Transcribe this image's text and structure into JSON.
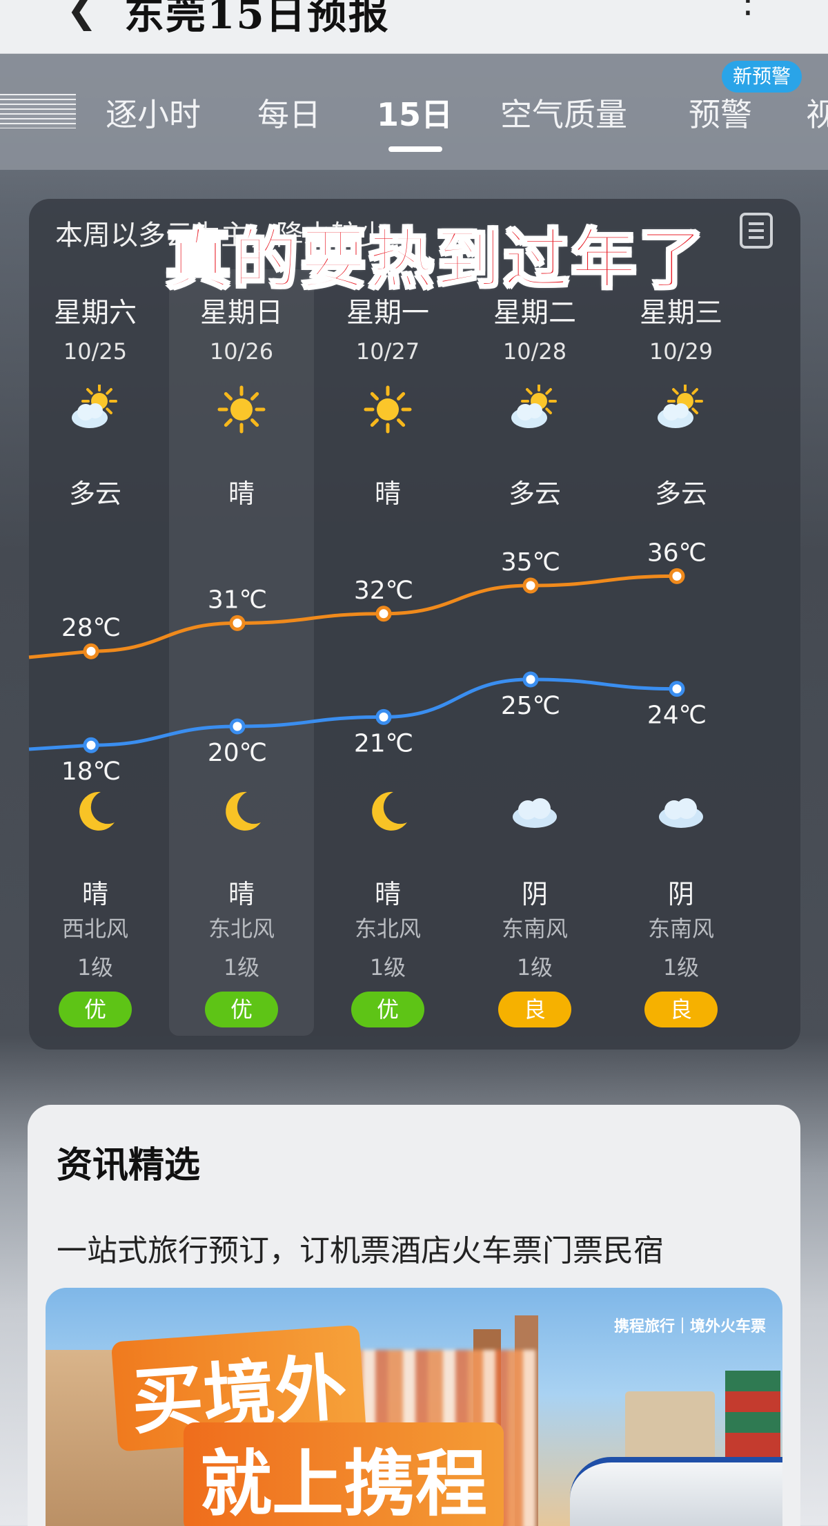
{
  "appbar": {
    "back_icon": "chevron-left-icon",
    "title": "东莞15日预报",
    "more_icon": "more-vertical-icon"
  },
  "tabs": [
    {
      "label": "逐小时",
      "active": false
    },
    {
      "label": "每日",
      "active": false
    },
    {
      "label": "15日",
      "active": true
    },
    {
      "label": "空气质量",
      "active": false
    },
    {
      "label": "预警",
      "active": false
    },
    {
      "label": "视",
      "active": false
    }
  ],
  "alert_badge": "新预警",
  "forecast": {
    "summary": "本周以多云为主，降水较少",
    "overlay_caption": "真的要热到过年了",
    "list_icon": "list-icon",
    "days": [
      {
        "weekday": "星期六",
        "date": "10/25",
        "day_icon": "partly-cloudy-icon",
        "day_cond": "多云",
        "high": "28℃",
        "low": "18℃",
        "night_icon": "moon-icon",
        "night_cond": "晴",
        "wind_dir": "西北风",
        "wind_lvl": "1级",
        "aqi": "优",
        "aqi_color": "#5ec416"
      },
      {
        "weekday": "星期日",
        "date": "10/26",
        "day_icon": "sun-icon",
        "day_cond": "晴",
        "high": "31℃",
        "low": "20℃",
        "night_icon": "moon-icon",
        "night_cond": "晴",
        "wind_dir": "东北风",
        "wind_lvl": "1级",
        "aqi": "优",
        "aqi_color": "#5ec416"
      },
      {
        "weekday": "星期一",
        "date": "10/27",
        "day_icon": "sun-icon",
        "day_cond": "晴",
        "high": "32℃",
        "low": "21℃",
        "night_icon": "moon-icon",
        "night_cond": "晴",
        "wind_dir": "东北风",
        "wind_lvl": "1级",
        "aqi": "优",
        "aqi_color": "#5ec416"
      },
      {
        "weekday": "星期二",
        "date": "10/28",
        "day_icon": "partly-cloudy-icon",
        "day_cond": "多云",
        "high": "35℃",
        "low": "25℃",
        "night_icon": "cloud-icon",
        "night_cond": "阴",
        "wind_dir": "东南风",
        "wind_lvl": "1级",
        "aqi": "良",
        "aqi_color": "#f6b100"
      },
      {
        "weekday": "星期三",
        "date": "10/29",
        "day_icon": "partly-cloudy-icon",
        "day_cond": "多云",
        "high": "36℃",
        "low": "24℃",
        "night_icon": "cloud-icon",
        "night_cond": "阴",
        "wind_dir": "东南风",
        "wind_lvl": "1级",
        "aqi": "良",
        "aqi_color": "#f6b100"
      }
    ],
    "colors": {
      "high_line": "#f08a1c",
      "low_line": "#3a8ef0"
    }
  },
  "chart_data": {
    "type": "line",
    "categories": [
      "10/25",
      "10/26",
      "10/27",
      "10/28",
      "10/29"
    ],
    "series": [
      {
        "values": [
          28,
          31,
          32,
          35,
          36
        ]
      },
      {
        "values": [
          18,
          20,
          21,
          25,
          24
        ]
      }
    ],
    "ylim": [
      15,
      40
    ]
  },
  "news": {
    "title": "资讯精选",
    "desc": "一站式旅行预订，订机票酒店火车票门票民宿",
    "ad_brand": "携程旅行｜境外火车票",
    "ad_line1": "买境外",
    "ad_line2": "就上携程"
  }
}
